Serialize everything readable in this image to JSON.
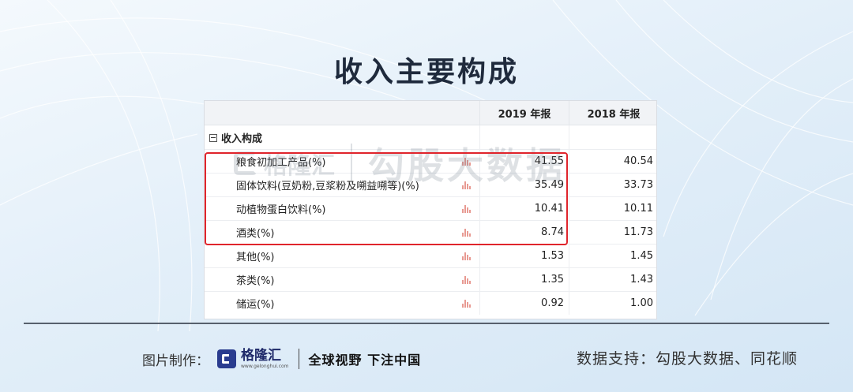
{
  "title": "收入主要构成",
  "table": {
    "columns": [
      "",
      "2019 年报",
      "2018 年报"
    ],
    "section": "收入构成",
    "rows": [
      {
        "label": "粮食初加工产品(%)",
        "y2019": "41.55",
        "y2018": "40.54"
      },
      {
        "label": "固体饮料(豆奶粉,豆浆粉及嗍益嗍等)(%)",
        "y2019": "35.49",
        "y2018": "33.73"
      },
      {
        "label": "动植物蛋白饮料(%)",
        "y2019": "10.41",
        "y2018": "10.11"
      },
      {
        "label": "酒类(%)",
        "y2019": "8.74",
        "y2018": "11.73"
      },
      {
        "label": "其他(%)",
        "y2019": "1.53",
        "y2018": "1.45"
      },
      {
        "label": "茶类(%)",
        "y2019": "1.35",
        "y2018": "1.43"
      },
      {
        "label": "储运(%)",
        "y2019": "0.92",
        "y2018": "1.00"
      }
    ]
  },
  "watermark": {
    "logo": "格隆汇",
    "text": "勾股大数据"
  },
  "footer": {
    "made_by": "图片制作：",
    "brand": "格隆汇",
    "brand_url": "www.gelonghui.com",
    "slogan": "全球视野 下注中国",
    "source": "数据支持：勾股大数据、同花顺"
  },
  "colors": {
    "highlight": "#e0242b",
    "brand": "#2a3c8f",
    "bar_icon": "#e89a92"
  }
}
